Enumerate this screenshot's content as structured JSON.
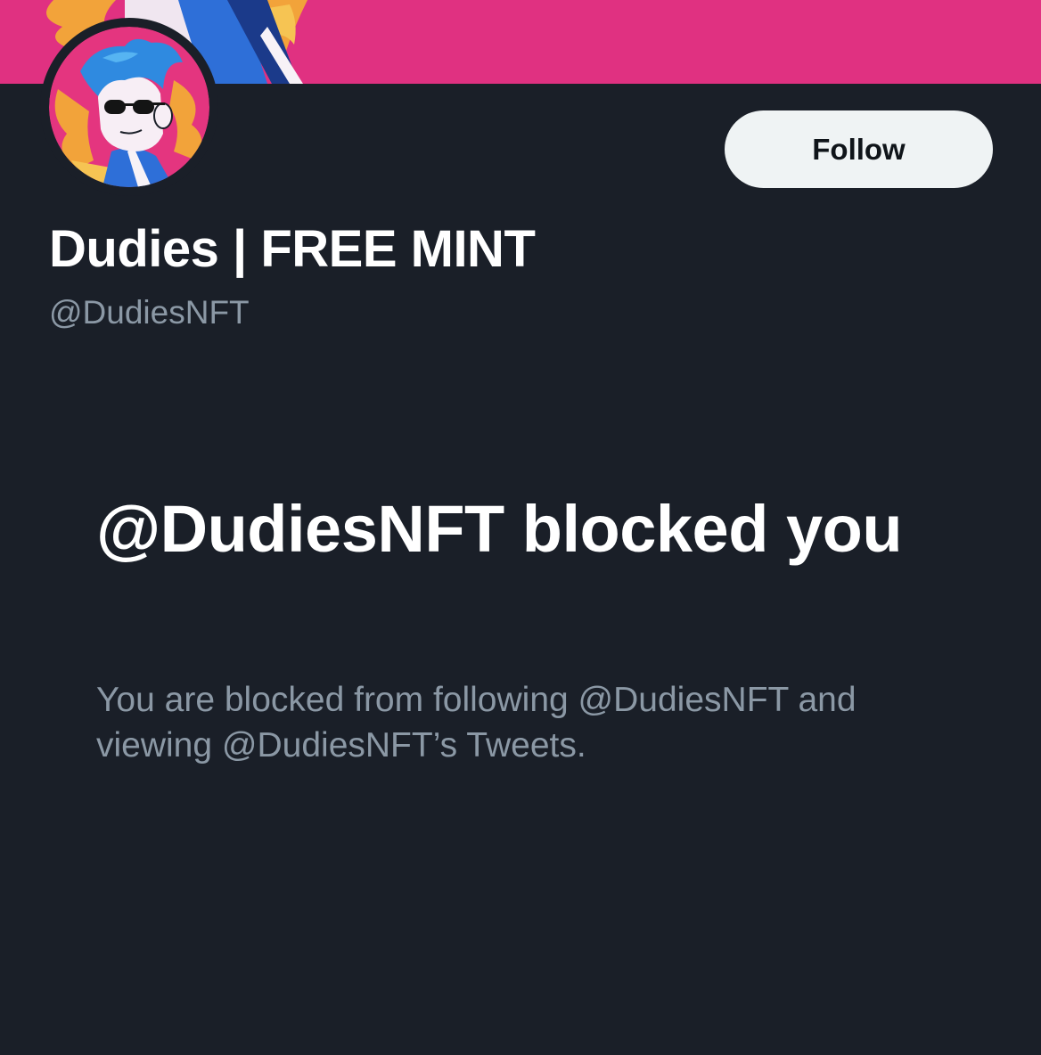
{
  "profile": {
    "display_name": "Dudies | FREE MINT",
    "handle": "@DudiesNFT",
    "follow_label": "Follow",
    "banner_color": "#e03181",
    "avatar_background_color": "#e4357f"
  },
  "blocked": {
    "title": "@DudiesNFT blocked you",
    "description": "You are blocked from following @DudiesNFT and viewing @DudiesNFT’s Tweets."
  },
  "theme": {
    "background": "#1a1f28",
    "primary_text": "#ffffff",
    "secondary_text": "#8b98a5"
  }
}
